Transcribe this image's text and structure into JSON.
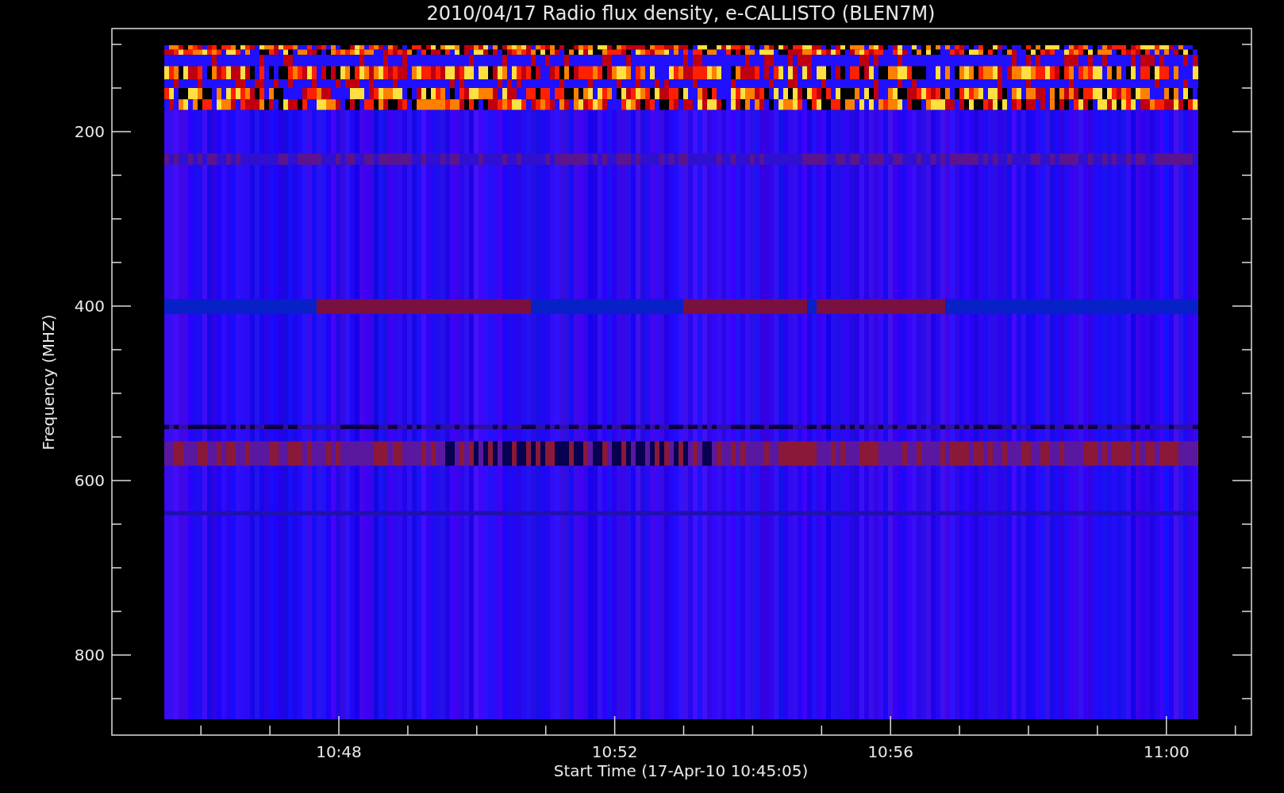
{
  "title": "2010/04/17  Radio flux density, e-CALLISTO (BLEN7M)",
  "y_axis": {
    "label": "Frequency (MHZ)",
    "ticks": [
      "200",
      "400",
      "600",
      "800"
    ]
  },
  "x_axis": {
    "label": "Start Time (17-Apr-10 10:45:05)",
    "ticks": [
      "10:48",
      "10:52",
      "10:56",
      "11:00"
    ]
  }
}
